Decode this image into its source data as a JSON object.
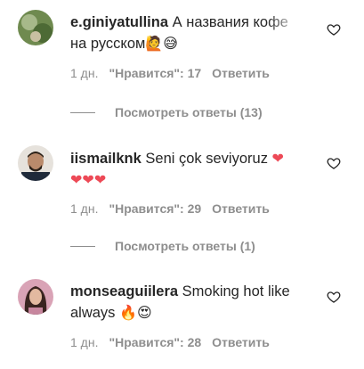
{
  "comments": [
    {
      "username": "e.giniyatullina",
      "text_line1": "А названия кофе",
      "text_line2": "на русском",
      "emoji": "🙋😅",
      "age": "1 дн.",
      "likes": "\"Нравится\": 17",
      "reply_label": "Ответить",
      "view_replies": "Посмотреть ответы (13)",
      "avatar_icon": "avatar-photo-green"
    },
    {
      "username": "iismailknk",
      "text_line1": "Seni çok seviyoruz",
      "emoji_inline": "❤",
      "emoji_line2": "❤❤❤",
      "age": "1 дн.",
      "likes": "\"Нравится\": 29",
      "reply_label": "Ответить",
      "view_replies": "Посмотреть ответы (1)",
      "avatar_icon": "avatar-photo-man"
    },
    {
      "username": "monseaguiilera",
      "text_line1": "Smoking hot like",
      "text_line2": "always",
      "emoji": "🔥😍",
      "age": "1 дн.",
      "likes": "\"Нравится\": 28",
      "reply_label": "Ответить",
      "avatar_icon": "avatar-photo-woman"
    }
  ],
  "colors": {
    "text": "#262626",
    "secondary": "#8e8e8e",
    "heart_red": "#ed4956",
    "background": "#ffffff"
  }
}
